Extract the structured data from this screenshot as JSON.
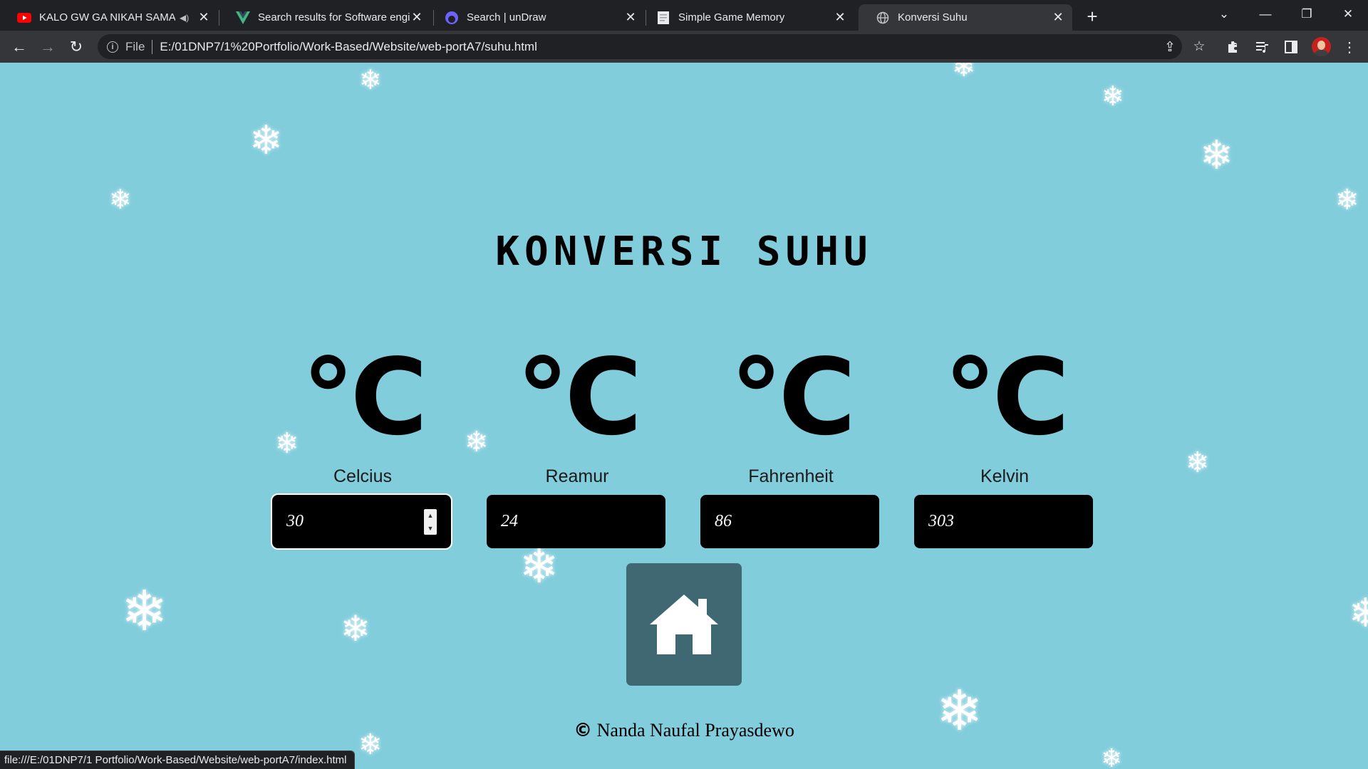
{
  "browser": {
    "tabs": [
      {
        "title": "KALO GW GA NIKAH SAMA LISA",
        "favicon": "youtube-icon",
        "audio": true,
        "active": false
      },
      {
        "title": "Search results for Software engineer",
        "favicon": "vue-icon",
        "audio": false,
        "active": false
      },
      {
        "title": "Search | unDraw",
        "favicon": "undraw-icon",
        "audio": false,
        "active": false
      },
      {
        "title": "Simple Game Memory",
        "favicon": "document-icon",
        "audio": false,
        "active": false
      },
      {
        "title": "Konversi Suhu",
        "favicon": "globe-icon",
        "audio": false,
        "active": true
      }
    ],
    "address": {
      "scheme": "File",
      "url": "E:/01DNP7/1%20Portfolio/Work-Based/Website/web-portA7/suhu.html"
    },
    "status_url": "file:///E:/01DNP7/1 Portfolio/Work-Based/Website/web-portA7/index.html"
  },
  "page": {
    "title": "KONVERSI SUHU",
    "units": [
      {
        "symbol": "°C",
        "label": "Celcius",
        "value": "30"
      },
      {
        "symbol": "°C",
        "label": "Reamur",
        "value": "24"
      },
      {
        "symbol": "°C",
        "label": "Fahrenheit",
        "value": "86"
      },
      {
        "symbol": "°C",
        "label": "Kelvin",
        "value": "303"
      }
    ],
    "home_icon": "home-icon",
    "footer": {
      "copyright_symbol": "©",
      "author": "Nanda Naufal Prayasdewo"
    }
  },
  "colors": {
    "page_background": "#81cddc",
    "input_background": "#000000",
    "home_button": "#3f6873",
    "chrome_dark": "#202124",
    "chrome_toolbar": "#35363a"
  }
}
